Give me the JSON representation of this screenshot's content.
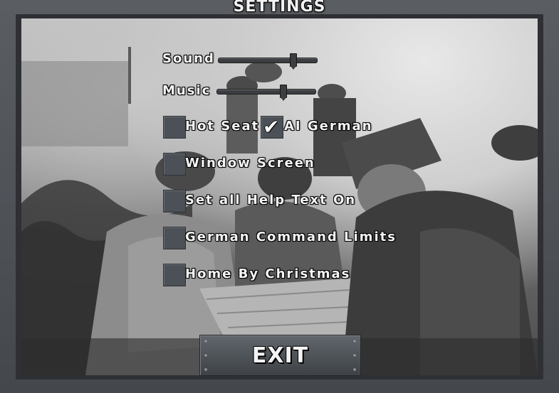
{
  "window": {
    "title": "SETTINGS"
  },
  "sliders": [
    {
      "label": "Sound",
      "value_percent": 77
    },
    {
      "label": "Music",
      "value_percent": 68
    }
  ],
  "options": [
    {
      "label": "Hot Seat",
      "checked": false
    },
    {
      "label": "AI German",
      "checked": true
    },
    {
      "label": "Window Screen",
      "checked": false
    },
    {
      "label": "Set all Help Text On",
      "checked": false
    },
    {
      "label": "German Command Limits",
      "checked": false
    },
    {
      "label": "Home By Christmas",
      "checked": false
    }
  ],
  "exit_button": {
    "label": "EXIT"
  },
  "icons": {
    "checkmark": "check-icon"
  },
  "colors": {
    "frame": "#4a4d52",
    "text": "#f4f4f4",
    "button": "#4f5459"
  }
}
